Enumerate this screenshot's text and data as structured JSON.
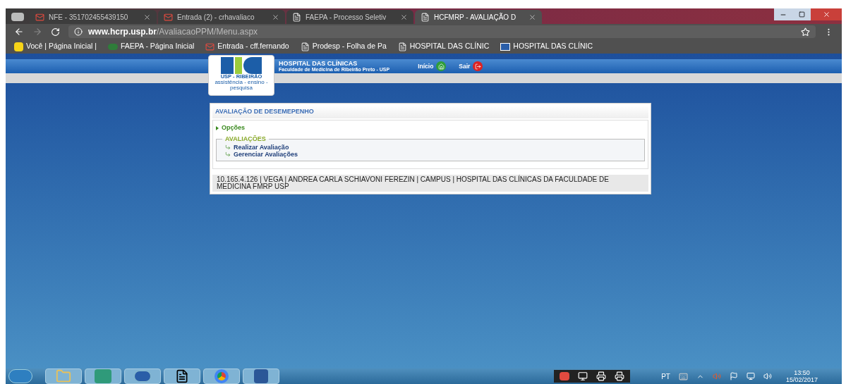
{
  "browser": {
    "tabs": [
      {
        "label": "NFE - 351702455439150",
        "kind": "mail",
        "selected": false
      },
      {
        "label": "Entrada (2) - crhavaliaco",
        "kind": "mail",
        "selected": false
      },
      {
        "label": "FAEPA - Processo Seletiv",
        "kind": "doc",
        "selected": false
      },
      {
        "label": "HCFMRP - AVALIAÇÃO D",
        "kind": "doc",
        "selected": true
      }
    ],
    "url_host": "www.hcrp.usp.br",
    "url_path": "/AvaliacaoPPM/Menu.aspx",
    "bookmarks": [
      {
        "label": "Você | Página Inicial |",
        "kind": "bank"
      },
      {
        "label": "FAEPA - Página Inicial",
        "kind": "faepa"
      },
      {
        "label": "Entrada - cff.fernando",
        "kind": "mail"
      },
      {
        "label": "Prodesp - Folha de Pa",
        "kind": "doc"
      },
      {
        "label": "HOSPITAL DAS CLÍNIC",
        "kind": "doc"
      },
      {
        "label": "HOSPITAL DAS CLÍNIC",
        "kind": "hc"
      }
    ]
  },
  "header": {
    "logo_caption": "USP - RIBEIRÃO",
    "logo_tagline": "assistência - ensino - pesquisa",
    "title": "HOSPITAL DAS CLÍNICAS",
    "subtitle": "Faculdade de Medicina de Ribeirão Preto - USP",
    "links": [
      {
        "label": "Início",
        "kind": "home"
      },
      {
        "label": "Sair",
        "kind": "exit"
      }
    ]
  },
  "panel": {
    "title": "AVALIAÇÃO DE DESEMEPENHO",
    "options_label": "Opções",
    "group_title": "AVALIAÇÕES",
    "items": [
      "Realizar Avaliação",
      "Gerenciar Avaliações"
    ],
    "footer": "10.165.4.126 | VEGA | ANDREA CARLA SCHIAVONI FEREZIN | CAMPUS | HOSPITAL DAS CLÍNICAS DA FACULDADE DE MEDICINA FMRP USP"
  },
  "taskbar": {
    "apps": [
      {
        "kind": "folder"
      },
      {
        "kind": "ap"
      },
      {
        "kind": "hc"
      },
      {
        "kind": "notepad"
      },
      {
        "kind": "chrome"
      },
      {
        "kind": "word"
      }
    ],
    "language": "PT",
    "time": "13:50",
    "date": "15/02/2017"
  }
}
